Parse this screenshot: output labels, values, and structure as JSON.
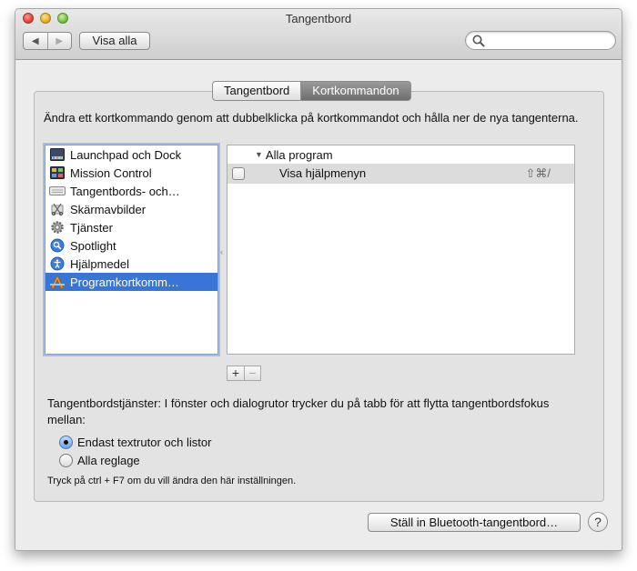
{
  "window": {
    "title": "Tangentbord"
  },
  "toolbar": {
    "back_icon": "chevron-left-icon",
    "forward_icon": "chevron-right-icon",
    "show_all_label": "Visa alla"
  },
  "search": {
    "value": "",
    "placeholder": ""
  },
  "tabs": [
    {
      "label": "Tangentbord",
      "selected": false
    },
    {
      "label": "Kortkommandon",
      "selected": true
    }
  ],
  "instructions": "Ändra ett kortkommando genom att dubbelklicka på kortkommandot och hålla ner de nya tangenterna.",
  "categories": [
    {
      "label": "Launchpad och Dock",
      "icon": "launchpad-dock-icon"
    },
    {
      "label": "Mission Control",
      "icon": "mission-control-icon"
    },
    {
      "label": "Tangentbords- och…",
      "icon": "keyboard-icon"
    },
    {
      "label": "Skärmavbilder",
      "icon": "screenshot-icon"
    },
    {
      "label": "Tjänster",
      "icon": "gear-icon"
    },
    {
      "label": "Spotlight",
      "icon": "spotlight-icon"
    },
    {
      "label": "Hjälpmedel",
      "icon": "accessibility-icon"
    },
    {
      "label": "Programkortkomm…",
      "icon": "app-shortcuts-icon",
      "selected": true
    }
  ],
  "shortcuts": {
    "group_label": "Alla program",
    "items": [
      {
        "name": "Visa hjälpmenyn",
        "keys": "⇧⌘/",
        "checked": false
      }
    ]
  },
  "buttons": {
    "add": "+",
    "remove": "−"
  },
  "keyboard_access": {
    "text": "Tangentbordstjänster: I fönster och dialogrutor trycker du på tabb för att flytta tangentbordsfokus mellan:",
    "options": [
      {
        "label": "Endast textrutor och listor",
        "selected": true
      },
      {
        "label": "Alla reglage",
        "selected": false
      }
    ],
    "hint": "Tryck på ctrl + F7 om du vill ändra den här inställningen."
  },
  "footer": {
    "bluetooth_button": "Ställ in Bluetooth-tangentbord…",
    "help_label": "?"
  },
  "colors": {
    "selection": "#3875d7",
    "active_tab": "#7d7d7d",
    "window_bg": "#ececec"
  }
}
